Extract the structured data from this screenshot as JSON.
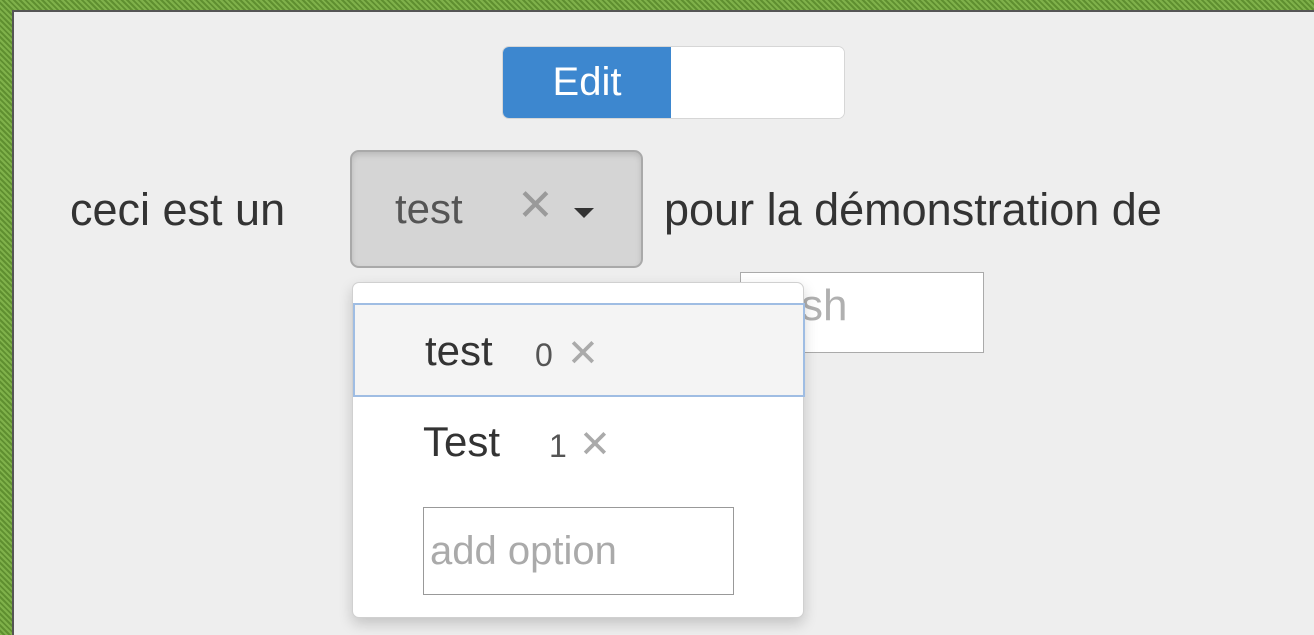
{
  "toggle": {
    "on_label": "Edit",
    "state": "on",
    "accent_color": "#3d87cf"
  },
  "sentence": {
    "before": "ceci est un",
    "after": "pour la démonstration de"
  },
  "select": {
    "value": "test",
    "clear_icon": "✕",
    "caret_icon": "caret-down-icon"
  },
  "bg_input": {
    "visible_text": "sh"
  },
  "dropdown": {
    "options": [
      {
        "label": "test",
        "index": "0",
        "remove_icon": "✕",
        "highlighted": true
      },
      {
        "label": "Test",
        "index": "1",
        "remove_icon": "✕",
        "highlighted": false
      }
    ],
    "add_option_placeholder": "add option"
  }
}
